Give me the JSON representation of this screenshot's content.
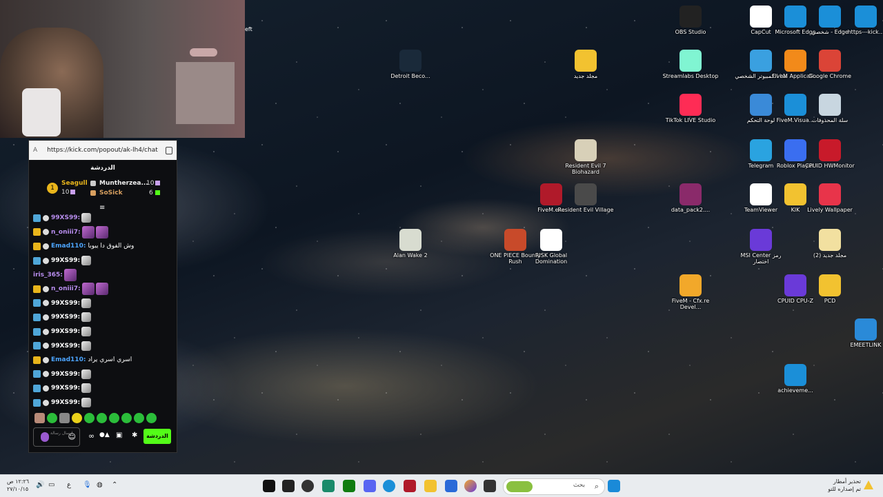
{
  "webcam": {
    "partial_text": "eft"
  },
  "chat": {
    "url": "https://kick.com/popout/ak-lh4/chat",
    "reader_icon": "A",
    "title": "الدردشة",
    "leaderboard": {
      "rank": "1",
      "first": {
        "name": "Seagull",
        "count": "10"
      },
      "second": {
        "name": "Muntherzea...",
        "count": "10"
      },
      "third": {
        "name": "SoSick",
        "count": "6"
      }
    },
    "messages": [
      {
        "badge": "blue",
        "user": "99XS99:",
        "user_color": "#b98ef0",
        "text": "",
        "emote": "small"
      },
      {
        "badge": "gold",
        "user": "n_oniii7:",
        "user_color": "#b98ef0",
        "text": "",
        "emote": "double"
      },
      {
        "badge": "gold",
        "user": "Emad110:",
        "user_color": "#4ca5ff",
        "text": "وش الفوق دا يبوبا",
        "emote": ""
      },
      {
        "badge": "blue",
        "user": "99XS99:",
        "user_color": "#ffffff",
        "text": "",
        "emote": "small"
      },
      {
        "badge": "none",
        "user": "iris_365:",
        "user_color": "#b98ef0",
        "text": "",
        "emote": "single"
      },
      {
        "badge": "gold",
        "user": "n_oniii7:",
        "user_color": "#b98ef0",
        "text": "",
        "emote": "double"
      },
      {
        "badge": "blue",
        "user": "99XS99:",
        "user_color": "#ffffff",
        "text": "",
        "emote": "small"
      },
      {
        "badge": "blue",
        "user": "99XS99:",
        "user_color": "#ffffff",
        "text": "",
        "emote": "small"
      },
      {
        "badge": "blue",
        "user": "99XS99:",
        "user_color": "#ffffff",
        "text": "",
        "emote": "small"
      },
      {
        "badge": "blue",
        "user": "99XS99:",
        "user_color": "#ffffff",
        "text": "",
        "emote": "small"
      },
      {
        "badge": "gold",
        "user": "Emad110:",
        "user_color": "#4ca5ff",
        "text": "اسري اسري يراد",
        "emote": ""
      },
      {
        "badge": "blue",
        "user": "99XS99:",
        "user_color": "#ffffff",
        "text": "",
        "emote": "small"
      },
      {
        "badge": "blue",
        "user": "99XS99:",
        "user_color": "#ffffff",
        "text": "",
        "emote": "small"
      },
      {
        "badge": "blue",
        "user": "99XS99:",
        "user_color": "#ffffff",
        "text": "",
        "emote": "small"
      }
    ],
    "send_label": "الدردشة",
    "input_placeholder": "إرسال رسالة"
  },
  "desktop_icons": [
    {
      "label": "Detroit Beco...",
      "color": "#1a2a3a"
    },
    {
      "label": "مجلد جديد",
      "color": "#f2c230"
    },
    {
      "label": "OBS Studio",
      "color": "#222222"
    },
    {
      "label": "CapCut",
      "color": "#ffffff"
    },
    {
      "label": "Microsoft Edge",
      "color": "#1b8fd8"
    },
    {
      "label": "شخصي - Edge",
      "color": "#1b8fd8"
    },
    {
      "label": "https---kick...",
      "color": "#1b8fd8"
    },
    {
      "label": "Streamlabs Desktop",
      "color": "#80f5d2"
    },
    {
      "label": "هذا الكمبيوتر الشخصي",
      "color": "#3aa0e0"
    },
    {
      "label": "FiveM Applicati...",
      "color": "#f28a1a"
    },
    {
      "label": "Google Chrome",
      "color": "#db4437"
    },
    {
      "label": "TikTok LIVE Studio",
      "color": "#fe2c55"
    },
    {
      "label": "لوحة التحكم",
      "color": "#3a8ad8"
    },
    {
      "label": "FiveM.Visua...",
      "color": "#1b8fd8"
    },
    {
      "label": "سلة المحذوفات",
      "color": "#c8d6e0"
    },
    {
      "label": "Resident Evil 7 Biohazard",
      "color": "#d8d0b8"
    },
    {
      "label": "Telegram",
      "color": "#2aa3e0"
    },
    {
      "label": "Roblox Player",
      "color": "#3a6ef0"
    },
    {
      "label": "CPUID HWMonitor",
      "color": "#c81a2a"
    },
    {
      "label": "FiveM.exe",
      "color": "#b01a2a"
    },
    {
      "label": "Resident Evil Village",
      "color": "#4a4a4a"
    },
    {
      "label": "data_pack2....",
      "color": "#8a2a6a"
    },
    {
      "label": "TeamViewer",
      "color": "#ffffff"
    },
    {
      "label": "KIK",
      "color": "#f2c230"
    },
    {
      "label": "Lively Wallpaper",
      "color": "#e8344a"
    },
    {
      "label": "Alan Wake 2",
      "color": "#d8dcd0"
    },
    {
      "label": "ONE PIECE Bounty Rush",
      "color": "#c84a2a"
    },
    {
      "label": "RISK Global Domination",
      "color": "#ffffff"
    },
    {
      "label": "MSI Center رمز اختصار",
      "color": "#6a3ad8"
    },
    {
      "label": "مجلد جديد (2)",
      "color": "#f2e0a0"
    },
    {
      "label": "FiveM - Cfx.re Devel...",
      "color": "#f2a82a"
    },
    {
      "label": "CPUID CPU-Z",
      "color": "#6a3ad8"
    },
    {
      "label": "PCD",
      "color": "#f2c230"
    },
    {
      "label": "EMEETLINK",
      "color": "#2a8ad8"
    },
    {
      "label": "achieveme...",
      "color": "#1b8fd8"
    }
  ],
  "taskbar": {
    "search_placeholder": "بحث",
    "clock_time": "١٢:٢٦ ص",
    "clock_date": "٢٧/١٠/١٥",
    "lang": "ع",
    "weather_title": "تحذير أمطار",
    "weather_sub": "تم إصداره للتو"
  }
}
